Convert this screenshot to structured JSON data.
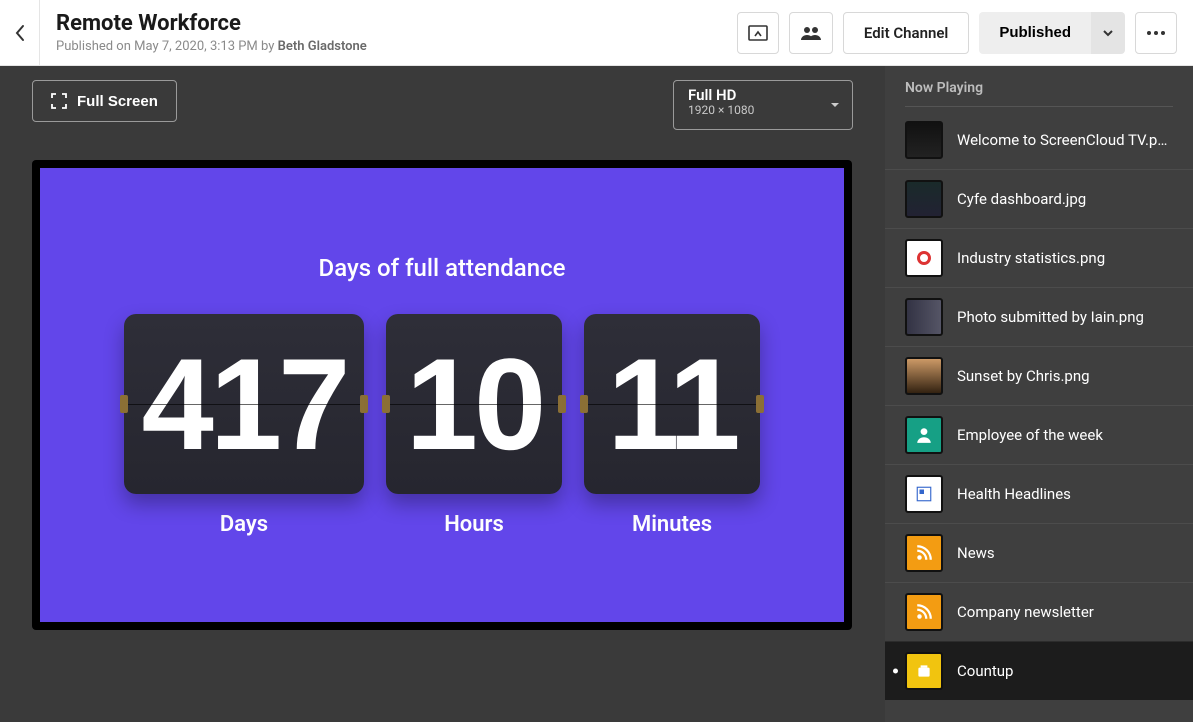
{
  "header": {
    "title": "Remote Workforce",
    "meta_prefix": "Published on ",
    "meta_date": "May 7, 2020, 3:13 PM",
    "meta_by": " by ",
    "author": "Beth Gladstone",
    "edit_label": "Edit Channel",
    "published_label": "Published"
  },
  "stage": {
    "fullscreen_label": "Full Screen",
    "resolution_name": "Full HD",
    "resolution_dim": "1920 × 1080"
  },
  "counter": {
    "title": "Days of full attendance",
    "days_value": "417",
    "days_label": "Days",
    "hours_value": "10",
    "hours_label": "Hours",
    "minutes_value": "11",
    "minutes_label": "Minutes"
  },
  "sidebar": {
    "now_playing": "Now Playing",
    "items": [
      {
        "label": "Welcome to ScreenCloud TV.png"
      },
      {
        "label": "Cyfe dashboard.jpg"
      },
      {
        "label": "Industry statistics.png"
      },
      {
        "label": "Photo submitted by Iain.png"
      },
      {
        "label": "Sunset by Chris.png"
      },
      {
        "label": "Employee of the week"
      },
      {
        "label": "Health Headlines"
      },
      {
        "label": "News"
      },
      {
        "label": "Company newsletter"
      },
      {
        "label": "Countup"
      }
    ]
  }
}
